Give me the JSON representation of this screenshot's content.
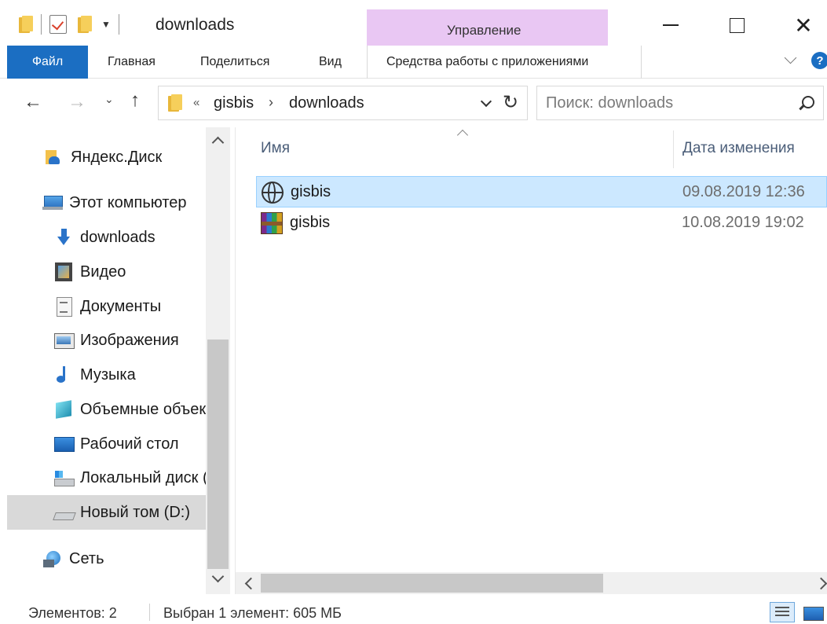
{
  "window": {
    "title": "downloads",
    "context_tab": "Управление",
    "close_glyph": "✕"
  },
  "ribbon": {
    "tabs": [
      "Файл",
      "Главная",
      "Поделиться",
      "Вид"
    ],
    "context_tools": "Средства работы с приложениями",
    "help": "?"
  },
  "address": {
    "overflow": "«",
    "crumbs": [
      "gisbis",
      "downloads"
    ],
    "separator": "›",
    "search_placeholder": "Поиск: downloads"
  },
  "nav_arrows": {
    "back": "←",
    "forward": "→",
    "recent": "⌄",
    "up": "↑",
    "refresh": "↻"
  },
  "nav_pane": {
    "items": [
      {
        "label": "Яндекс.Диск",
        "icon": "yandex-disk-icon"
      },
      {
        "label": "Этот компьютер",
        "icon": "computer-icon"
      },
      {
        "label": "downloads",
        "icon": "download-arrow-icon"
      },
      {
        "label": "Видео",
        "icon": "video-icon"
      },
      {
        "label": "Документы",
        "icon": "documents-icon"
      },
      {
        "label": "Изображения",
        "icon": "pictures-icon"
      },
      {
        "label": "Музыка",
        "icon": "music-icon"
      },
      {
        "label": "Объемные объекты",
        "icon": "3d-objects-icon"
      },
      {
        "label": "Рабочий стол",
        "icon": "desktop-icon"
      },
      {
        "label": "Локальный диск (C:)",
        "icon": "local-disk-icon"
      },
      {
        "label": "Новый том (D:)",
        "icon": "volume-icon",
        "selected": true
      },
      {
        "label": "Сеть",
        "icon": "network-icon"
      }
    ]
  },
  "file_list": {
    "columns": [
      "Имя",
      "Дата изменения"
    ],
    "rows": [
      {
        "name": "gisbis",
        "modified": "09.08.2019 12:36",
        "icon": "globe-icon",
        "selected": true
      },
      {
        "name": "gisbis",
        "modified": "10.08.2019 19:02",
        "icon": "winrar-archive-icon",
        "selected": false
      }
    ]
  },
  "status": {
    "item_count": "Элементов: 2",
    "selection": "Выбран 1 элемент: 605 МБ"
  },
  "colors": {
    "accent": "#1b6ec2",
    "context_tab": "#e9c7f3",
    "selection_bg": "#cce8ff",
    "nav_selected_bg": "#d9d9d9"
  }
}
